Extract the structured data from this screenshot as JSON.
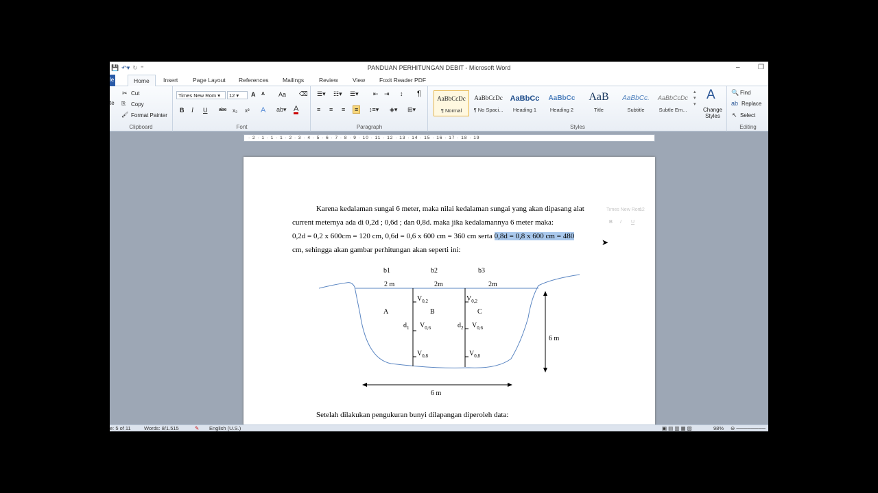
{
  "window": {
    "title": "PANDUAN PERHITUNGAN DEBIT  -  Microsoft Word"
  },
  "tabs": {
    "file": "le",
    "home": "Home",
    "insert": "Insert",
    "page_layout": "Page Layout",
    "references": "References",
    "mailings": "Mailings",
    "review": "Review",
    "view": "View",
    "foxit": "Foxit Reader PDF"
  },
  "clipboard": {
    "paste": "te",
    "cut": "Cut",
    "copy": "Copy",
    "format_painter": "Format Painter",
    "name": "Clipboard"
  },
  "font": {
    "family": "Times New Rom",
    "size": "12",
    "name": "Font",
    "bold": "B",
    "italic": "I",
    "underline": "U",
    "strike": "abc",
    "sub": "x₂",
    "sup": "x²",
    "grow": "A",
    "shrink": "A",
    "case": "Aa"
  },
  "paragraph": {
    "name": "Paragraph"
  },
  "styles": {
    "name": "Styles",
    "items": [
      {
        "preview": "AaBbCcDc",
        "name": "¶ Normal"
      },
      {
        "preview": "AaBbCcDc",
        "name": "¶ No Spaci..."
      },
      {
        "preview": "AaBbCc",
        "name": "Heading 1"
      },
      {
        "preview": "AaBbCc",
        "name": "Heading 2"
      },
      {
        "preview": "AaB",
        "name": "Title"
      },
      {
        "preview": "AaBbCc.",
        "name": "Subtitle"
      },
      {
        "preview": "AaBbCcDc",
        "name": "Subtle Em..."
      }
    ],
    "change_styles": "Change Styles"
  },
  "editing": {
    "find": "Find",
    "replace": "Replace",
    "select": "Select",
    "name": "Editing"
  },
  "ruler": {
    "text": "· 2 · 1 · 1 · 1 · 2 · 3 · 4 · 5 · 6 · 7 · 8 · 9 · 10 · 11 · 12 · 13 · 14 · 15 · 16 · 17 · 18 · 19"
  },
  "doc": {
    "line1": "Karena kedalaman sungai 6 meter, maka nilai kedalaman sungai yang akan dipasang alat",
    "line2": "current meternya ada di 0,2d ; 0,6d ; dan 0,8d. maka jika kedalamannya 6 meter maka:",
    "line3a": "0,2d = 0,2 x 600cm = 120 cm, 0,6d = 0,6 x 600 cm = 360 cm serta ",
    "line3b": "0,8d = 0,8 x 600 cm = 480",
    "line4": "cm, sehingga akan gambar perhitungan akan seperti ini:",
    "line5": "Setelah dilakukan pengukuran bunyi dilapangan diperoleh data:"
  },
  "diagram": {
    "b1": "b1",
    "b2": "b2",
    "b3": "b3",
    "w1": "2 m",
    "w2": "2m",
    "w3": "2m",
    "A": "A",
    "B": "B",
    "C": "C",
    "d1": "d",
    "d1sub": "1",
    "d2": "d",
    "d2sub": "2",
    "v": "V",
    "v02": "0,2",
    "v06": "0,6",
    "v08": "0,8",
    "depth": "6 m",
    "width": "6 m"
  },
  "status": {
    "page": "e: 5 of 11",
    "words": "Words: 8/1.515",
    "lang": "English (U.S.)",
    "zoom": "98%"
  }
}
